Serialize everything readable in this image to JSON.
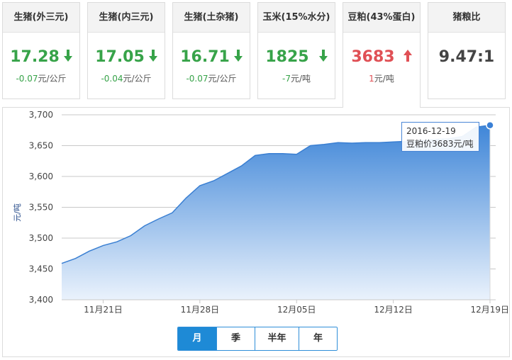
{
  "cards": [
    {
      "title": "生猪(外三元)",
      "price": "17.28",
      "change_value": "-0.07",
      "change_unit": "元/公斤",
      "direction": "down"
    },
    {
      "title": "生猪(内三元)",
      "price": "17.05",
      "change_value": "-0.04",
      "change_unit": "元/公斤",
      "direction": "down"
    },
    {
      "title": "生猪(土杂猪)",
      "price": "16.71",
      "change_value": "-0.07",
      "change_unit": "元/公斤",
      "direction": "down"
    },
    {
      "title": "玉米(15%水分)",
      "price": "1825",
      "change_value": "-7",
      "change_unit": "元/吨",
      "direction": "down"
    },
    {
      "title": "豆粕(43%蛋白)",
      "price": "3683",
      "change_value": "1",
      "change_unit": "元/吨",
      "direction": "up",
      "active": true
    },
    {
      "title": "猪粮比",
      "price": "9.47:1",
      "change_value": "",
      "change_unit": "",
      "direction": "none"
    }
  ],
  "colors": {
    "down": "#37a349",
    "up": "#e05055",
    "accent": "#1e8ad6",
    "area_top": "#3f86d8",
    "area_bottom": "#eaf2fc"
  },
  "tooltip": {
    "date": "2016-12-19",
    "text": "豆粕价3683元/吨"
  },
  "tabs": [
    {
      "label": "月",
      "active": true
    },
    {
      "label": "季",
      "active": false
    },
    {
      "label": "半年",
      "active": false
    },
    {
      "label": "年",
      "active": false
    }
  ],
  "chart_data": {
    "type": "area",
    "ylabel": "元/吨",
    "ylim": [
      3400,
      3700
    ],
    "yticks": [
      3400,
      3450,
      3500,
      3550,
      3600,
      3650,
      3700
    ],
    "ytick_labels": [
      "3,400",
      "3,450",
      "3,500",
      "3,550",
      "3,600",
      "3,650",
      "3,700"
    ],
    "xtick_labels": [
      "11月21日",
      "11月28日",
      "12月05日",
      "12月12日",
      "12月19日"
    ],
    "grid": true,
    "x": [
      "2016-11-18",
      "2016-11-19",
      "2016-11-20",
      "2016-11-21",
      "2016-11-22",
      "2016-11-23",
      "2016-11-24",
      "2016-11-25",
      "2016-11-26",
      "2016-11-27",
      "2016-11-28",
      "2016-11-29",
      "2016-11-30",
      "2016-12-01",
      "2016-12-02",
      "2016-12-03",
      "2016-12-04",
      "2016-12-05",
      "2016-12-06",
      "2016-12-07",
      "2016-12-08",
      "2016-12-09",
      "2016-12-10",
      "2016-12-11",
      "2016-12-12",
      "2016-12-13",
      "2016-12-14",
      "2016-12-15",
      "2016-12-16",
      "2016-12-17",
      "2016-12-18",
      "2016-12-19"
    ],
    "values": [
      3459,
      3467,
      3479,
      3488,
      3494,
      3504,
      3520,
      3531,
      3541,
      3565,
      3585,
      3593,
      3605,
      3617,
      3634,
      3637,
      3637,
      3636,
      3650,
      3652,
      3655,
      3654,
      3655,
      3655,
      3656,
      3657,
      3658,
      3660,
      3661,
      3665,
      3680,
      3683
    ]
  }
}
